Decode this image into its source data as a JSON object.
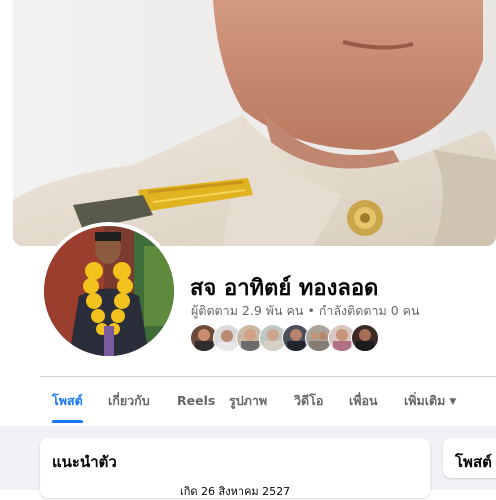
{
  "profile": {
    "name": "สจ อาทิตย์ ทองลอด",
    "followers_text": "ผู้ติดตาม 2.9 พัน คน",
    "separator": "•",
    "following_text": "กำลังติดตาม 0 คน"
  },
  "tabs": [
    {
      "label": "โพสต์",
      "active": true
    },
    {
      "label": "เกี่ยวกับ",
      "active": false
    },
    {
      "label": "Reels",
      "active": false
    },
    {
      "label": "รูปภาพ",
      "active": false
    },
    {
      "label": "วิดีโอ",
      "active": false
    },
    {
      "label": "เพื่อน",
      "active": false
    },
    {
      "label": "เพิ่มเติม",
      "active": false
    }
  ],
  "intro": {
    "title": "แนะนำตัว",
    "birthday": "เกิด 26 สิงหาคม 2527"
  },
  "posts": {
    "title": "โพสต์"
  },
  "colors": {
    "accent": "#1877f2",
    "secondary_text": "#65676b",
    "page_bg": "#f0f2f5"
  },
  "friend_count_shown": 8
}
